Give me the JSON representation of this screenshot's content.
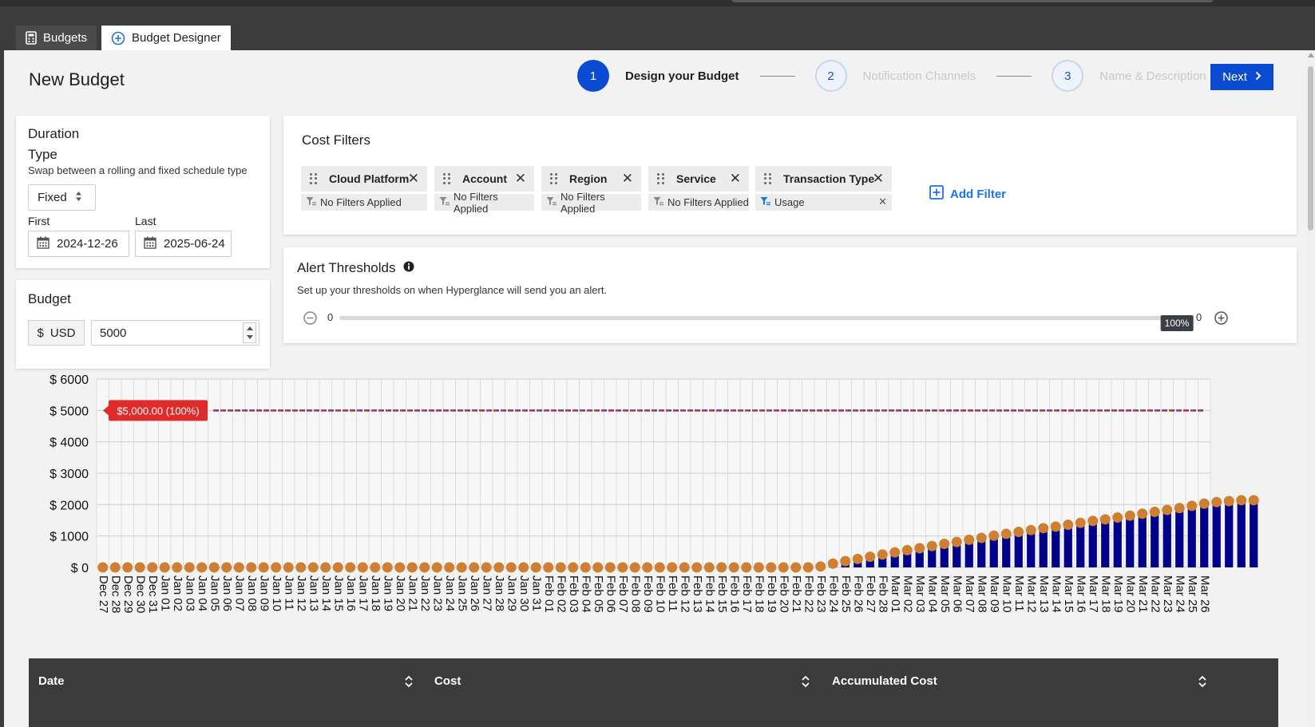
{
  "tabs": [
    {
      "label": "Budgets",
      "icon": "calculator-icon"
    },
    {
      "label": "Budget Designer",
      "icon": "plus-circle-icon"
    }
  ],
  "page": {
    "title": "New Budget"
  },
  "stepper": {
    "steps": [
      {
        "number": "1",
        "label": "Design your Budget",
        "state": "active"
      },
      {
        "number": "2",
        "label": "Notification Channels",
        "state": "pending"
      },
      {
        "number": "3",
        "label": "Name & Description",
        "state": "pending"
      }
    ],
    "next_label": "Next"
  },
  "duration": {
    "title": "Duration",
    "type_label": "Type",
    "type_help": "Swap between a rolling and fixed schedule type",
    "type_value": "Fixed",
    "first_label": "First",
    "first_value": "2024-12-26",
    "last_label": "Last",
    "last_value": "2025-06-24"
  },
  "budget": {
    "title": "Budget",
    "currency_symbol": "$",
    "currency": "USD",
    "amount": "5000"
  },
  "cost_filters": {
    "title": "Cost Filters",
    "filters": [
      {
        "name": "Cloud Platform",
        "value": "No Filters Applied",
        "active": false
      },
      {
        "name": "Account",
        "value": "No Filters Applied",
        "active": false
      },
      {
        "name": "Region",
        "value": "No Filters Applied",
        "active": false
      },
      {
        "name": "Service",
        "value": "No Filters Applied",
        "active": false
      },
      {
        "name": "Transaction Type",
        "value": "Usage",
        "active": true
      }
    ],
    "add_label": "Add Filter"
  },
  "alerts": {
    "title": "Alert Thresholds",
    "help": "Set up your thresholds on when Hyperglance will send you an alert.",
    "min_label": "0",
    "max_label": "0",
    "threshold_label": "100%",
    "threshold_fraction": 1.0
  },
  "colors": {
    "primary": "#0b4bd1",
    "bar": "#00008b",
    "dot": "#cd7f32",
    "threshold": "#e0242d",
    "link": "#1a73e8"
  },
  "chart_data": {
    "type": "bar",
    "ylim": [
      0,
      6000
    ],
    "yticks": [
      "$ 0",
      "$ 1000",
      "$ 2000",
      "$ 3000",
      "$ 4000",
      "$ 5000",
      "$ 6000"
    ],
    "categories": [
      "Dec 27",
      "Dec 28",
      "Dec 29",
      "Dec 30",
      "Dec 31",
      "Jan 01",
      "Jan 02",
      "Jan 03",
      "Jan 04",
      "Jan 05",
      "Jan 06",
      "Jan 07",
      "Jan 08",
      "Jan 09",
      "Jan 10",
      "Jan 11",
      "Jan 12",
      "Jan 13",
      "Jan 14",
      "Jan 15",
      "Jan 16",
      "Jan 17",
      "Jan 18",
      "Jan 19",
      "Jan 20",
      "Jan 21",
      "Jan 22",
      "Jan 23",
      "Jan 24",
      "Jan 25",
      "Jan 26",
      "Jan 27",
      "Jan 28",
      "Jan 29",
      "Jan 30",
      "Jan 31",
      "Feb 01",
      "Feb 02",
      "Feb 03",
      "Feb 04",
      "Feb 05",
      "Feb 06",
      "Feb 07",
      "Feb 08",
      "Feb 09",
      "Feb 10",
      "Feb 11",
      "Feb 12",
      "Feb 13",
      "Feb 14",
      "Feb 15",
      "Feb 16",
      "Feb 17",
      "Feb 18",
      "Feb 19",
      "Feb 20",
      "Feb 21",
      "Feb 22",
      "Feb 23",
      "Feb 24",
      "Feb 25",
      "Feb 26",
      "Feb 27",
      "Feb 28",
      "Mar 01",
      "Mar 02",
      "Mar 03",
      "Mar 04",
      "Mar 05",
      "Mar 06",
      "Mar 07",
      "Mar 08",
      "Mar 09",
      "Mar 10",
      "Mar 11",
      "Mar 12",
      "Mar 13",
      "Mar 14",
      "Mar 15",
      "Mar 16",
      "Mar 17",
      "Mar 18",
      "Mar 19",
      "Mar 20",
      "Mar 21",
      "Mar 22",
      "Mar 23",
      "Mar 24",
      "Mar 25",
      "Mar 26"
    ],
    "series": [
      {
        "values": [
          0,
          0,
          0,
          0,
          0,
          0,
          0,
          0,
          0,
          0,
          0,
          0,
          0,
          0,
          0,
          0,
          0,
          0,
          0,
          0,
          0,
          0,
          0,
          0,
          0,
          0,
          0,
          0,
          0,
          0,
          0,
          0,
          0,
          0,
          0,
          0,
          0,
          0,
          0,
          0,
          0,
          0,
          0,
          0,
          0,
          0,
          0,
          0,
          0,
          0,
          0,
          0,
          0,
          0,
          0,
          0,
          0,
          0,
          30,
          120,
          200,
          270,
          340,
          410,
          480,
          550,
          610,
          680,
          750,
          810,
          880,
          940,
          1010,
          1070,
          1130,
          1190,
          1250,
          1300,
          1360,
          1420,
          1480,
          1530,
          1590,
          1650,
          1710,
          1770,
          1830,
          1890,
          1960,
          2030,
          2080,
          2110,
          2140,
          2140
        ]
      }
    ],
    "threshold": {
      "value": 5000,
      "label": "$5,000.00 (100%)"
    },
    "grid": true
  },
  "table": {
    "columns": [
      "Date",
      "Cost",
      "Accumulated Cost"
    ]
  }
}
